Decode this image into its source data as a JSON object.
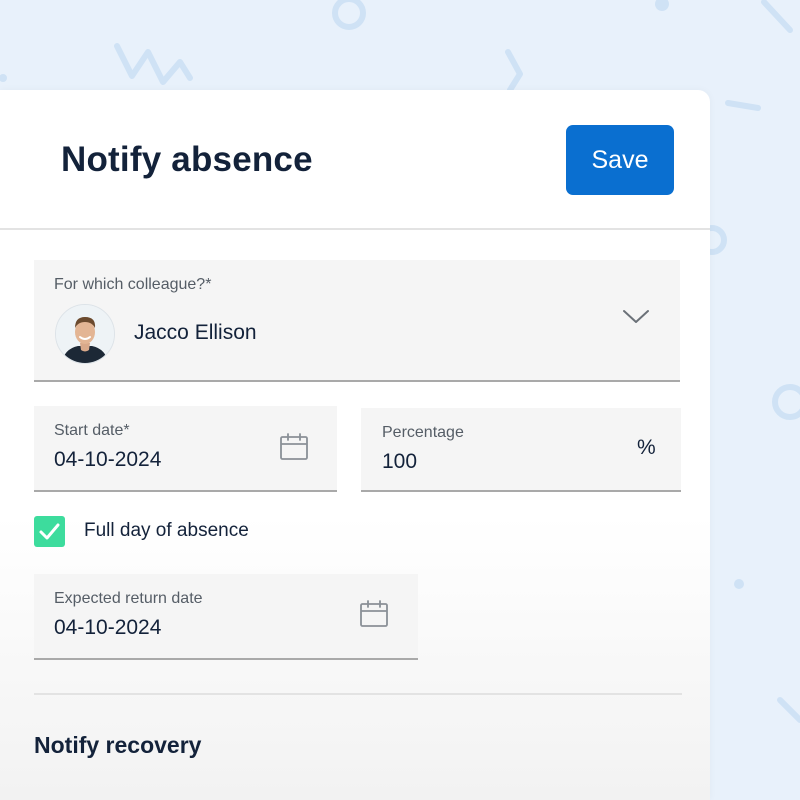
{
  "header": {
    "title": "Notify absence",
    "save_label": "Save"
  },
  "colleague": {
    "label": "For which colleague?*",
    "name": "Jacco Ellison",
    "avatar_icon": "person-avatar",
    "dropdown_icon": "chevron-down-icon"
  },
  "start_date": {
    "label": "Start date*",
    "value": "04-10-2024",
    "icon": "calendar-icon"
  },
  "percentage": {
    "label": "Percentage",
    "value": "100",
    "unit": "%"
  },
  "full_day": {
    "label": "Full day of absence",
    "checked": true
  },
  "expected_return": {
    "label": "Expected return date",
    "value": "04-10-2024",
    "icon": "calendar-icon"
  },
  "recovery": {
    "title": "Notify recovery"
  },
  "colors": {
    "primary": "#0a6fd0",
    "check": "#3ddc9d",
    "background": "#e8f1fb",
    "text": "#13223a"
  }
}
